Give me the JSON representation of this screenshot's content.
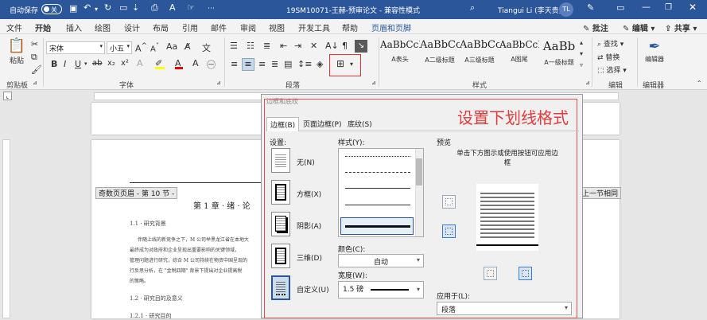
{
  "titlebar": {
    "autosave": "自动保存",
    "toggle": "关",
    "doc_title": "19SM10071-王赫-预审论文 - 兼容性模式",
    "user": "Tiangui Li (李天贵)",
    "initials": "TL"
  },
  "tabs": [
    "文件",
    "开始",
    "插入",
    "绘图",
    "设计",
    "布局",
    "引用",
    "邮件",
    "审阅",
    "视图",
    "开发工具",
    "帮助",
    "页眉和页脚"
  ],
  "tab_active": "开始",
  "tab_right": {
    "search_icon": "search-icon",
    "annotate": "批注",
    "edit": "编辑",
    "share": "共享"
  },
  "ribbon": {
    "paste": "粘贴",
    "clipboard": "剪贴板",
    "font_name": "宋体",
    "font_size": "小五",
    "font_group": "字体",
    "paragraph_group": "段落",
    "styles_group": "样式",
    "editing_group": "编辑",
    "editor_group": "编辑器",
    "find": "查找",
    "replace": "替换",
    "select": "选择",
    "styles": [
      {
        "sample": "AaBbCcDd",
        "name": "A表头"
      },
      {
        "sample": "AaBbCc",
        "name": "A二级标题"
      },
      {
        "sample": "AaBbCc",
        "name": "A三级标题"
      },
      {
        "sample": "AaBbCcDd",
        "name": "A图尾"
      },
      {
        "sample": "AaBb",
        "name": "A一级标题"
      }
    ],
    "editor": "编辑器"
  },
  "doc": {
    "prev_section": "上一节相同",
    "footer_tag": "奇数页页眉 - 第 10 节 -",
    "chapter": "第 1 章 · 绪 · 论",
    "lines": [
      "1.1 · 研究背景",
      "伴随上线的新竞争之下，M 公司举黑龙江省在本地大",
      "最终成为对政府和企业呈现出重要影响的关键领域，",
      "管理问题进行研究，综合 M 公司持续在物资中国呈现的",
      "行反思分析，在 \"金税四期\" 背景下提出对企业提高税",
      "的策略。",
      "1.2 · 研究目的及意义",
      "1.2.1 · 研究目的"
    ]
  },
  "callout": "设置下划线格式",
  "dialog": {
    "title": "边框和底纹",
    "tabs": [
      "边框(B)",
      "页面边框(P)",
      "底纹(S)"
    ],
    "settings_label": "设置:",
    "settings": [
      "无(N)",
      "方框(X)",
      "阴影(A)",
      "三维(D)",
      "自定义(U)"
    ],
    "style_label": "样式(Y):",
    "color_label": "颜色(C):",
    "color_value": "自动",
    "width_label": "宽度(W):",
    "width_value": "1.5 磅",
    "preview_label": "预览",
    "preview_hint": "单击下方图示或使用按钮可应用边框",
    "apply_label": "应用于(L):",
    "apply_value": "段落"
  }
}
